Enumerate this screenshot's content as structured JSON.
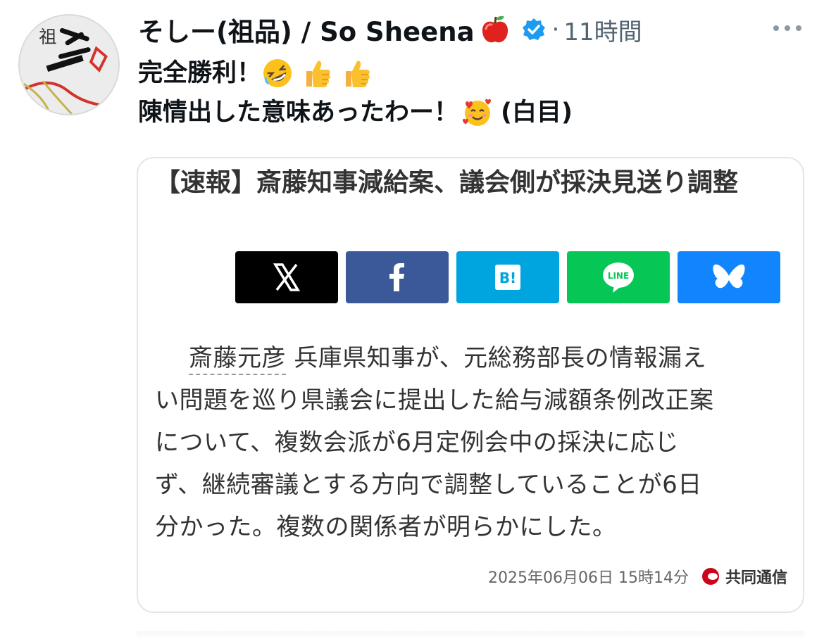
{
  "author": {
    "display_name": "そしー(祖品) / So Sheena",
    "name_emoji": "red-apple-emoji",
    "verified": true,
    "verified_color": "#1d9bf0",
    "timestamp": "11時間",
    "separator": "·",
    "avatar_text": "祖"
  },
  "tweet": {
    "line1": {
      "text": "完全勝利！",
      "emojis": [
        "rolling-on-floor-laughing-emoji",
        "thumbs-up-emoji",
        "thumbs-up-emoji"
      ]
    },
    "line2": {
      "text": "陳情出した意味あったわー！",
      "emoji": "smiling-face-with-hearts-emoji",
      "suffix": "(白目)"
    }
  },
  "article": {
    "headline": "【速報】斎藤知事減給案、議会側が採決見送り調整",
    "share_buttons": [
      {
        "name": "X",
        "icon": "x-logo-icon",
        "color": "#000000"
      },
      {
        "name": "Facebook",
        "icon": "facebook-icon",
        "color": "#3b5998"
      },
      {
        "name": "Hatena Bookmark",
        "icon": "hatena-bookmark-icon",
        "label": "B!",
        "color": "#00a4de"
      },
      {
        "name": "LINE",
        "icon": "line-icon",
        "label": "LINE",
        "color": "#06c755"
      },
      {
        "name": "Bluesky",
        "icon": "bluesky-icon",
        "color": "#1185fe"
      }
    ],
    "body_link": "斎藤元彦",
    "body_line1": "兵庫県知事が、元総務部長の情報漏え",
    "body_line2": "い問題を巡り県議会に提出した給与減額条例改正案",
    "body_line3": "について、複数会派が6月定例会中の採決に応じ",
    "body_line4": "ず、継続審議とする方向で調整していることが6日",
    "body_line5": "分かった。複数の関係者が明らかにした。",
    "date": "2025年06月06日 15時14分",
    "source": "共同通信"
  }
}
